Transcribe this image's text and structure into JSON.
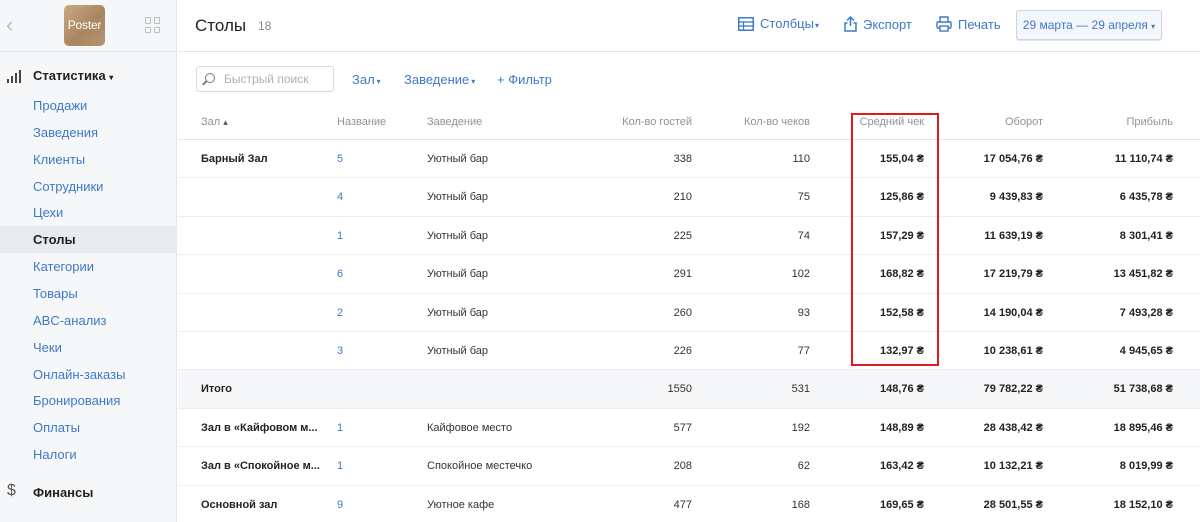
{
  "app": {
    "logo_text": "Poster"
  },
  "sidebar": {
    "section_label": "Статистика",
    "section_caret": "▾",
    "items": [
      {
        "label": "Продажи",
        "active": false
      },
      {
        "label": "Заведения",
        "active": false
      },
      {
        "label": "Клиенты",
        "active": false
      },
      {
        "label": "Сотрудники",
        "active": false
      },
      {
        "label": "Цехи",
        "active": false
      },
      {
        "label": "Столы",
        "active": true
      },
      {
        "label": "Категории",
        "active": false
      },
      {
        "label": "Товары",
        "active": false
      },
      {
        "label": "ABC-анализ",
        "active": false
      },
      {
        "label": "Чеки",
        "active": false
      },
      {
        "label": "Онлайн-заказы",
        "active": false
      },
      {
        "label": "Бронирования",
        "active": false
      },
      {
        "label": "Оплаты",
        "active": false
      },
      {
        "label": "Налоги",
        "active": false
      }
    ],
    "finance_icon": "$",
    "finance_label": "Финансы"
  },
  "header": {
    "title": "Столы",
    "count": "18",
    "columns_label": "Столбцы",
    "export_label": "Экспорт",
    "print_label": "Печать",
    "date_range": "29 марта — 29 апреля",
    "caret": "▾"
  },
  "filters": {
    "search_placeholder": "Быстрый поиск",
    "hall": "Зал",
    "venue": "Заведение",
    "add_filter": "+ Фильтр",
    "caret": "▾"
  },
  "table": {
    "columns": {
      "hall": "Зал",
      "sort_indicator": "▴",
      "name": "Название",
      "venue": "Заведение",
      "guests": "Кол-во гостей",
      "checks": "Кол-во чеков",
      "avg_check": "Средний чек",
      "turnover": "Оборот",
      "profit": "Прибыль"
    },
    "rows": [
      {
        "hall": "Барный Зал",
        "name": "5",
        "venue": "Уютный бар",
        "guests": "338",
        "checks": "110",
        "avg": "155,04 ₴",
        "turnover": "17 054,76 ₴",
        "profit": "11 110,74 ₴"
      },
      {
        "hall": "",
        "name": "4",
        "venue": "Уютный бар",
        "guests": "210",
        "checks": "75",
        "avg": "125,86 ₴",
        "turnover": "9 439,83 ₴",
        "profit": "6 435,78 ₴"
      },
      {
        "hall": "",
        "name": "1",
        "venue": "Уютный бар",
        "guests": "225",
        "checks": "74",
        "avg": "157,29 ₴",
        "turnover": "11 639,19 ₴",
        "profit": "8 301,41 ₴"
      },
      {
        "hall": "",
        "name": "6",
        "venue": "Уютный бар",
        "guests": "291",
        "checks": "102",
        "avg": "168,82 ₴",
        "turnover": "17 219,79 ₴",
        "profit": "13 451,82 ₴"
      },
      {
        "hall": "",
        "name": "2",
        "venue": "Уютный бар",
        "guests": "260",
        "checks": "93",
        "avg": "152,58 ₴",
        "turnover": "14 190,04 ₴",
        "profit": "7 493,28 ₴"
      },
      {
        "hall": "",
        "name": "3",
        "venue": "Уютный бар",
        "guests": "226",
        "checks": "77",
        "avg": "132,97 ₴",
        "turnover": "10 238,61 ₴",
        "profit": "4 945,65 ₴"
      },
      {
        "hall": "Итого",
        "name": "",
        "venue": "",
        "guests": "1550",
        "checks": "531",
        "avg": "148,76 ₴",
        "turnover": "79 782,22 ₴",
        "profit": "51 738,68 ₴",
        "total": true
      },
      {
        "hall": "Зал в «Кайфовом м...",
        "name": "1",
        "venue": "Кайфовое место",
        "guests": "577",
        "checks": "192",
        "avg": "148,89 ₴",
        "turnover": "28 438,42 ₴",
        "profit": "18 895,46 ₴"
      },
      {
        "hall": "Зал в «Спокойное м...",
        "name": "1",
        "venue": "Спокойное местечко",
        "guests": "208",
        "checks": "62",
        "avg": "163,42 ₴",
        "turnover": "10 132,21 ₴",
        "profit": "8 019,99 ₴"
      },
      {
        "hall": "Основной зал",
        "name": "9",
        "venue": "Уютное кафе",
        "guests": "477",
        "checks": "168",
        "avg": "169,65 ₴",
        "turnover": "28 501,55 ₴",
        "profit": "18 152,10 ₴"
      }
    ]
  },
  "colors": {
    "accent": "#3f79c7",
    "highlight": "#e01b1b"
  }
}
